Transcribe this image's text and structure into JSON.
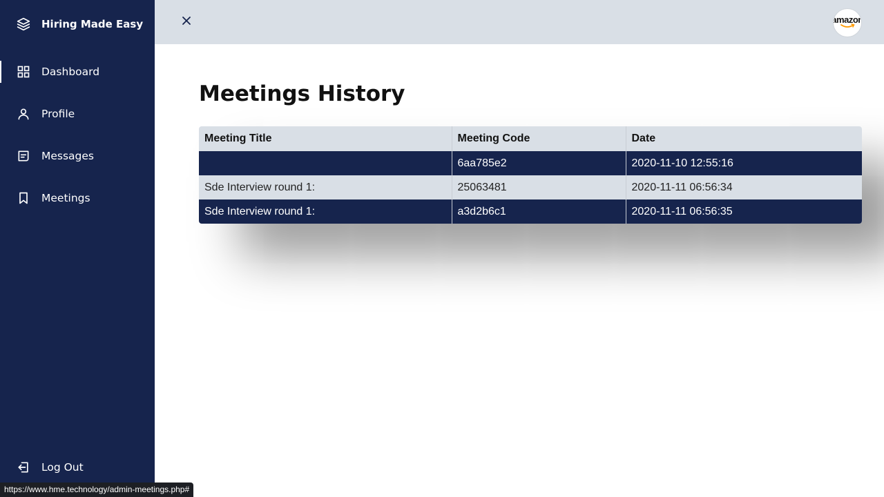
{
  "app": {
    "brand": "Hiring Made Easy"
  },
  "sidebar": {
    "items": [
      {
        "label": "Dashboard",
        "icon": "grid-icon",
        "active": true
      },
      {
        "label": "Profile",
        "icon": "user-icon"
      },
      {
        "label": "Messages",
        "icon": "message-icon"
      },
      {
        "label": "Meetings",
        "icon": "bookmark-icon"
      }
    ],
    "logout": {
      "label": "Log Out",
      "icon": "logout-icon"
    }
  },
  "topbar": {
    "avatar_text": "amazon",
    "close_icon": "close-icon"
  },
  "main": {
    "title": "Meetings History",
    "table": {
      "headers": [
        "Meeting Title",
        "Meeting Code",
        "Date"
      ],
      "rows": [
        [
          "",
          "6aa785e2",
          "2020-11-10 12:55:16"
        ],
        [
          "Sde Interview round 1:",
          "25063481",
          "2020-11-11 06:56:34"
        ],
        [
          "Sde Interview round 1:",
          "a3d2b6c1",
          "2020-11-11 06:56:35"
        ]
      ]
    }
  },
  "status_bar": {
    "url": "https://www.hme.technology/admin-meetings.php#"
  },
  "colors": {
    "sidebar": "#16244d",
    "topbar": "#d9dfe6",
    "row_dark": "#16244d",
    "row_light": "#d9dfe6"
  }
}
